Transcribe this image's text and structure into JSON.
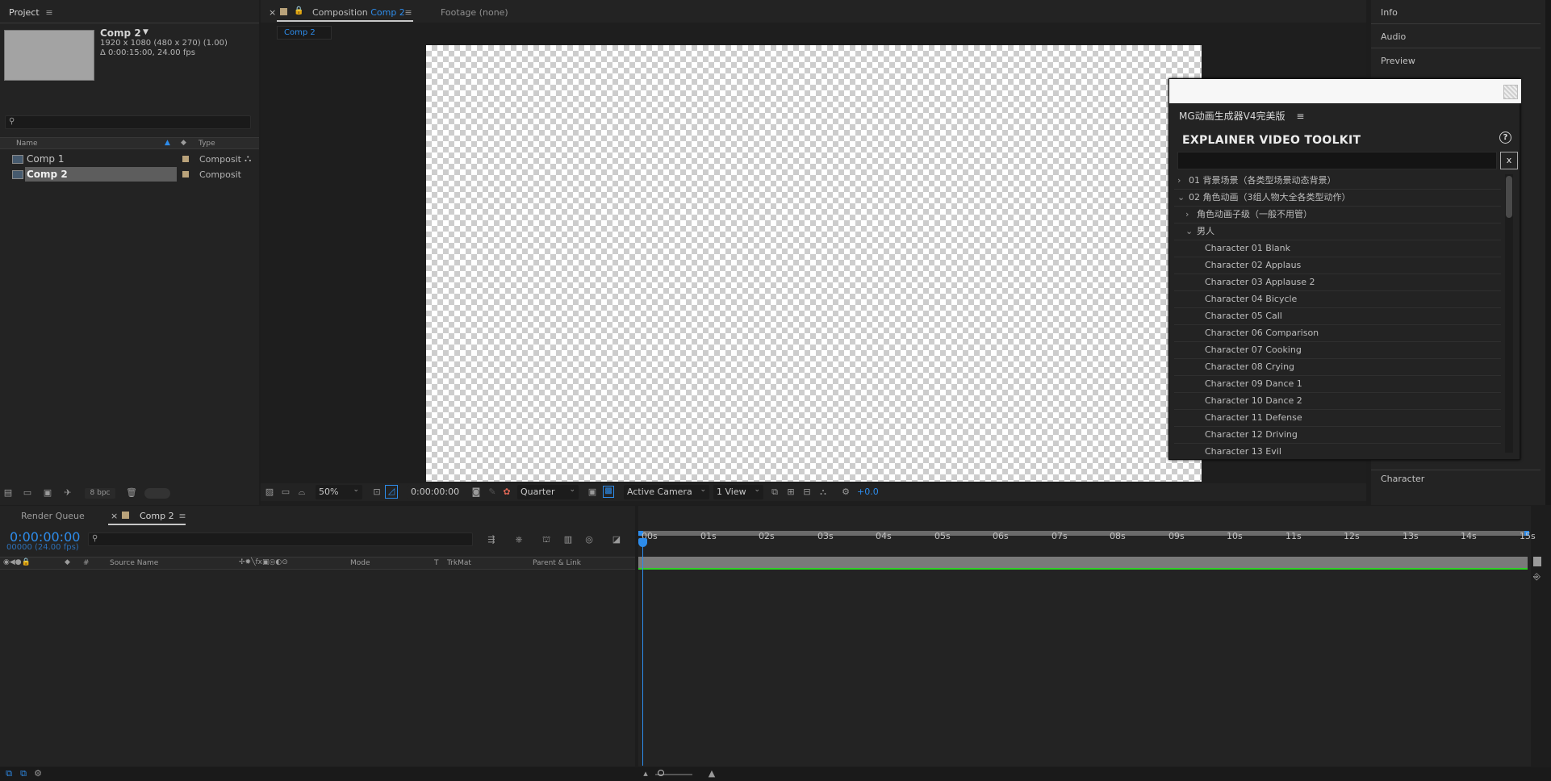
{
  "project": {
    "title": "Project",
    "comp_name": "Comp 2",
    "comp_res": "1920 x 1080  (480 x 270) (1.00)",
    "comp_dur": "Δ 0:00:15:00, 24.00 fps",
    "col_name": "Name",
    "col_type": "Type",
    "items": [
      {
        "name": "Comp 1",
        "type": "Composit"
      },
      {
        "name": "Comp 2",
        "type": "Composit"
      }
    ],
    "bpc": "8 bpc"
  },
  "composition": {
    "tab_prefix": "Composition",
    "tab_comp": "Comp 2",
    "footage_tab": "Footage",
    "footage_value": "(none)",
    "sub_tab": "Comp 2",
    "zoom": "50%",
    "timecode": "0:00:00:00",
    "resolution": "Quarter",
    "camera": "Active Camera",
    "views": "1 View",
    "exposure": "+0.0"
  },
  "right_dock": {
    "items": [
      "Info",
      "Audio",
      "Preview"
    ],
    "bottom_item": "Character"
  },
  "toolkit": {
    "panel_title": "MG动画生成器V4完美版",
    "heading": "EXPLAINER VIDEO TOOLKIT",
    "help": "?",
    "clear": "x",
    "tree": [
      {
        "label": "01 背景场景（各类型场景动态背景）",
        "level": 0,
        "toggle": "›"
      },
      {
        "label": "02 角色动画（3组人物大全各类型动作）",
        "level": 0,
        "toggle": "⌄"
      },
      {
        "label": "角色动画子级（一般不用管）",
        "level": 1,
        "toggle": "›"
      },
      {
        "label": "男人",
        "level": 1,
        "toggle": "⌄"
      },
      {
        "label": "Character 01 Blank",
        "level": 2,
        "toggle": ""
      },
      {
        "label": "Character 02 Applaus",
        "level": 2,
        "toggle": ""
      },
      {
        "label": "Character 03 Applause 2",
        "level": 2,
        "toggle": ""
      },
      {
        "label": "Character 04 Bicycle",
        "level": 2,
        "toggle": ""
      },
      {
        "label": "Character 05 Call",
        "level": 2,
        "toggle": ""
      },
      {
        "label": "Character 06 Comparison",
        "level": 2,
        "toggle": ""
      },
      {
        "label": "Character 07 Cooking",
        "level": 2,
        "toggle": ""
      },
      {
        "label": "Character 08 Crying",
        "level": 2,
        "toggle": ""
      },
      {
        "label": "Character 09 Dance 1",
        "level": 2,
        "toggle": ""
      },
      {
        "label": "Character 10 Dance 2",
        "level": 2,
        "toggle": ""
      },
      {
        "label": "Character 11 Defense",
        "level": 2,
        "toggle": ""
      },
      {
        "label": "Character 12 Driving",
        "level": 2,
        "toggle": ""
      },
      {
        "label": "Character 13 Evil",
        "level": 2,
        "toggle": ""
      }
    ]
  },
  "timeline": {
    "render_queue_tab": "Render Queue",
    "comp_tab": "Comp 2",
    "timecode": "0:00:00:00",
    "frames": "00000 (24.00 fps)",
    "col_hash": "#",
    "col_source": "Source Name",
    "col_mode": "Mode",
    "col_t": "T",
    "col_trkmat": "TrkMat",
    "col_parent": "Parent & Link",
    "ruler": [
      "00s",
      "01s",
      "02s",
      "03s",
      "04s",
      "05s",
      "06s",
      "07s",
      "08s",
      "09s",
      "10s",
      "11s",
      "12s",
      "13s",
      "14s",
      "15s"
    ]
  }
}
